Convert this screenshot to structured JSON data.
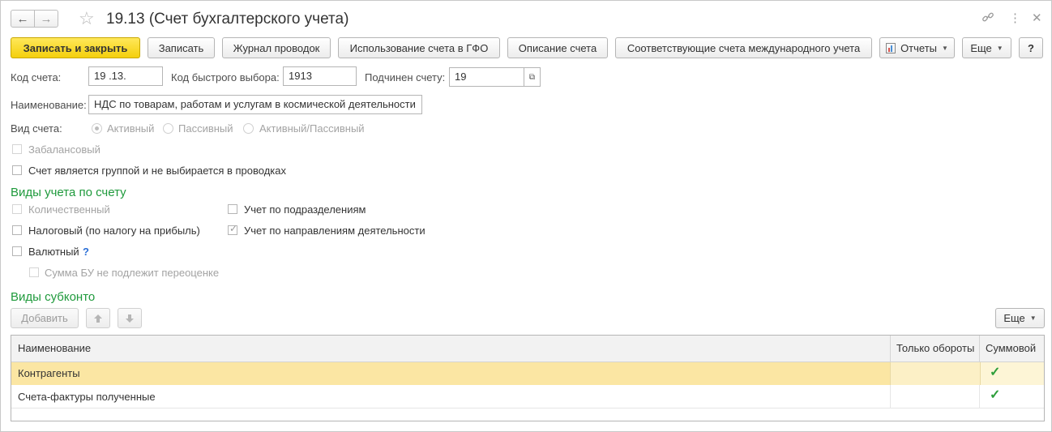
{
  "window": {
    "title": "19.13 (Счет бухгалтерского учета)",
    "nav_back_icon": "←",
    "nav_forward_icon": "→",
    "star_icon": "☆",
    "link_icon": "🔗",
    "menu_icon": "⋮",
    "close_icon": "✕"
  },
  "toolbar": {
    "save_close": "Записать и закрыть",
    "save": "Записать",
    "journal": "Журнал проводок",
    "usage_gfo": "Использование счета в ГФО",
    "description": "Описание счета",
    "international": "Соответствующие счета международного учета",
    "reports": "Отчеты",
    "more": "Еще",
    "help": "?"
  },
  "fields": {
    "code_label": "Код счета:",
    "code_value": "19 .13.",
    "quick_label": "Код быстрого выбора:",
    "quick_value": "1913",
    "parent_label": "Подчинен счету:",
    "parent_value": "19",
    "name_label": "Наименование:",
    "name_value": "НДС по товарам, работам и услугам в космической деятельности",
    "type_label": "Вид счета:",
    "type_active": "Активный",
    "type_passive": "Пассивный",
    "type_both": "Активный/Пассивный",
    "offbalance": "Забалансовый",
    "is_group": "Счет является группой и не выбирается в проводках"
  },
  "accounting_section": {
    "title": "Виды учета по счету",
    "quantity": "Количественный",
    "tax": "Налоговый (по налогу на прибыль)",
    "currency": "Валютный",
    "currency_help": "?",
    "no_revaluation": "Сумма БУ не подлежит переоценке",
    "by_department": "Учет по подразделениям",
    "by_activity": "Учет по направлениям деятельности"
  },
  "subconto_section": {
    "title": "Виды субконто",
    "add": "Добавить",
    "up_icon": "🡅",
    "down_icon": "🡇",
    "more": "Еще",
    "columns": [
      "Наименование",
      "Только обороты",
      "Суммовой"
    ],
    "rows": [
      {
        "name": "Контрагенты",
        "turnover_only": false,
        "sum": true
      },
      {
        "name": "Счета-фактуры полученные",
        "turnover_only": false,
        "sum": true
      }
    ],
    "check_mark": "✓"
  }
}
